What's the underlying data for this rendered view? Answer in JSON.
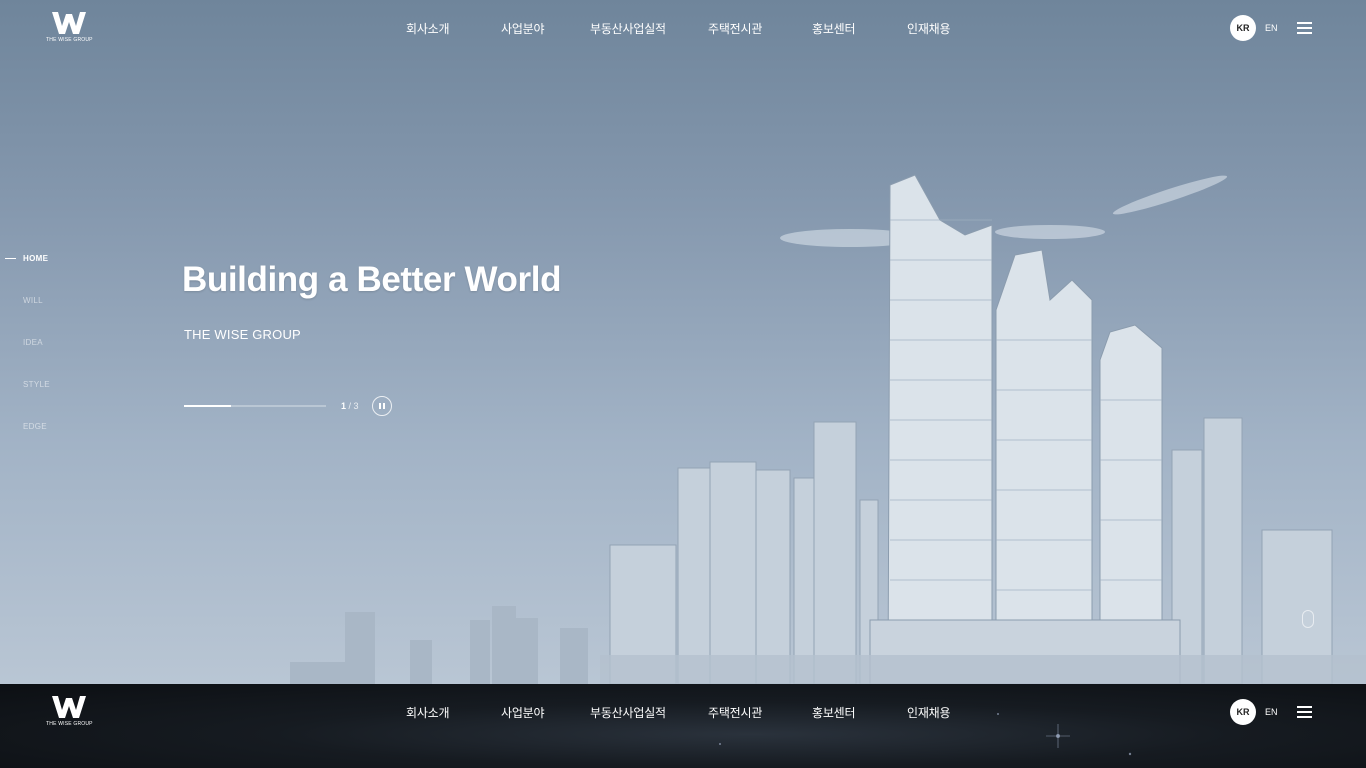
{
  "brand": {
    "logo_text": "THE WISE GROUP"
  },
  "nav": {
    "items": [
      "회사소개",
      "사업분야",
      "부동산사업실적",
      "주택전시관",
      "홍보센터",
      "인재채용"
    ],
    "lang_kr": "KR",
    "lang_en": "EN"
  },
  "side_nav": {
    "items": [
      "HOME",
      "WILL",
      "IDEA",
      "STYLE",
      "EDGE"
    ],
    "active": "HOME"
  },
  "hero": {
    "title": "Building a Better World",
    "subtitle": "THE WISE GROUP",
    "slide_current": "1",
    "slide_separator": " / ",
    "slide_total": "3",
    "progress": 0.33
  },
  "footer": {
    "logo_text": "THE WISE GROUP",
    "nav_items": [
      "회사소개",
      "사업분야",
      "부동산사업실적",
      "주택전시관",
      "홍보센터",
      "인재채용"
    ],
    "lang_kr": "KR",
    "lang_en": "EN"
  },
  "icons": {
    "logo": "w-logo-icon",
    "menu": "hamburger-menu-icon",
    "pause": "pause-icon",
    "scroll": "mouse-scroll-icon"
  }
}
